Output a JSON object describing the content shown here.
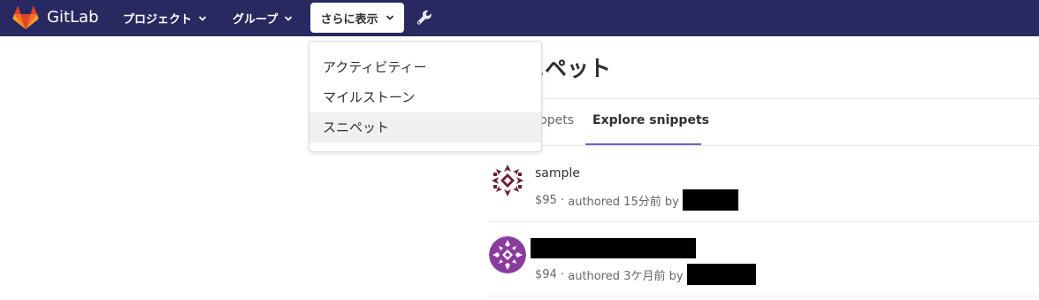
{
  "navbar": {
    "brand": "GitLab",
    "projects_label": "プロジェクト",
    "groups_label": "グループ",
    "more_label": "さらに表示",
    "bg_color": "#292961",
    "icons": [
      "gitlab-logo",
      "chevron-down-icon",
      "wrench-icon"
    ]
  },
  "dropdown": {
    "items": [
      {
        "label": "アクティビティー"
      },
      {
        "label": "マイルストーン"
      },
      {
        "label": "スニペット",
        "active": true
      }
    ]
  },
  "page": {
    "title": "スニペット",
    "tabs": [
      {
        "label": "All snippets",
        "active": false
      },
      {
        "label": "Explore snippets",
        "active": true
      }
    ],
    "accent_color": "#6666c4"
  },
  "snippets": [
    {
      "title": "sample",
      "id": "$95",
      "authored": "authored 15分前 by",
      "author_redacted": true
    },
    {
      "title": "",
      "title_redacted": true,
      "id": "$94",
      "authored": "authored 3ケ月前 by",
      "author_redacted": true
    }
  ]
}
